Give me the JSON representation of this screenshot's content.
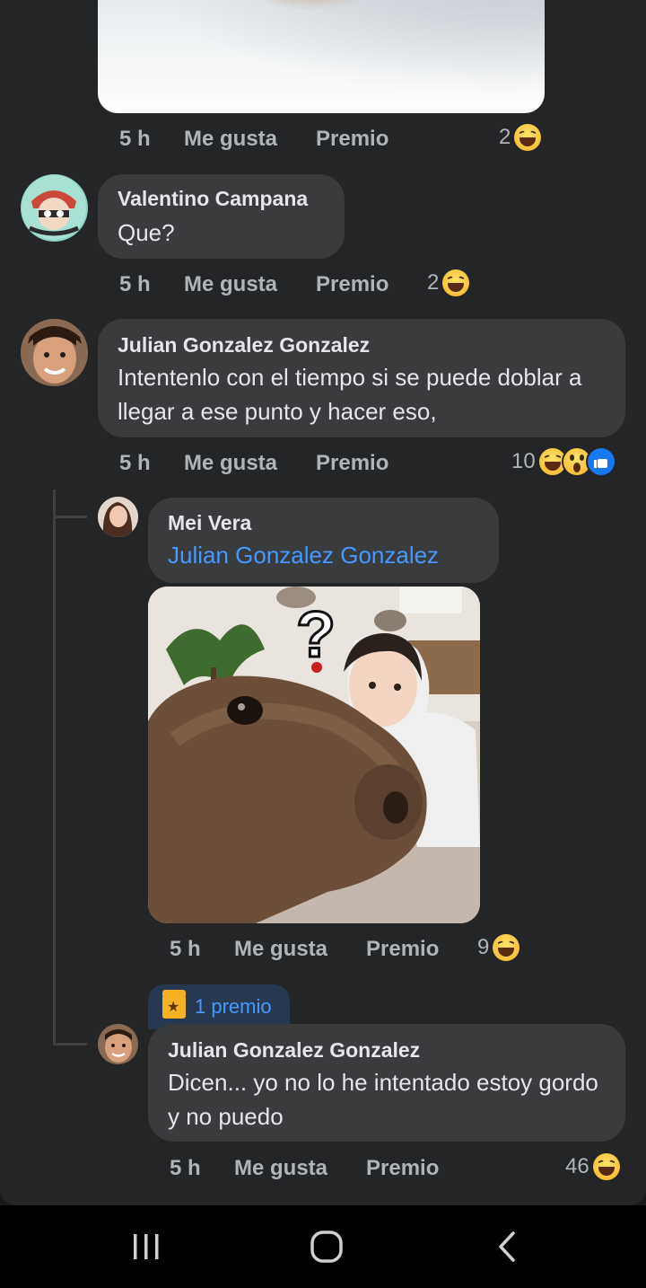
{
  "comments": [
    {
      "time": "5 h",
      "like": "Me gusta",
      "award": "Premio",
      "reaction_count": "2",
      "reactions": [
        "haha"
      ]
    },
    {
      "author": "Valentino Campana",
      "text": "Que?",
      "time": "5 h",
      "like": "Me gusta",
      "award": "Premio",
      "reaction_count": "2",
      "reactions": [
        "haha"
      ]
    },
    {
      "author": "Julian Gonzalez Gonzalez",
      "text": "Intentenlo con el tiempo si se puede doblar a llegar a ese punto y hacer eso,",
      "time": "5 h",
      "like": "Me gusta",
      "award": "Premio",
      "reaction_count": "10",
      "reactions": [
        "haha",
        "wow",
        "like"
      ]
    }
  ],
  "replies": [
    {
      "author": "Mei Vera",
      "mention": "Julian Gonzalez Gonzalez",
      "image_marks": "?",
      "time": "5 h",
      "like": "Me gusta",
      "award": "Premio",
      "reaction_count": "9",
      "reactions": [
        "haha"
      ]
    },
    {
      "award_badge": "1 premio",
      "author": "Julian Gonzalez Gonzalez",
      "text": "Dicen... yo no lo he intentado estoy gordo y no puedo",
      "time": "5 h",
      "like": "Me gusta",
      "award": "Premio",
      "reaction_count": "46",
      "reactions": [
        "haha"
      ]
    }
  ],
  "colors": {
    "background": "#242526",
    "bubble": "#3a3b3c",
    "mention": "#4599ff",
    "meta": "#b0b3b8"
  },
  "nav": [
    "recent-apps-icon",
    "home-icon",
    "back-icon"
  ]
}
